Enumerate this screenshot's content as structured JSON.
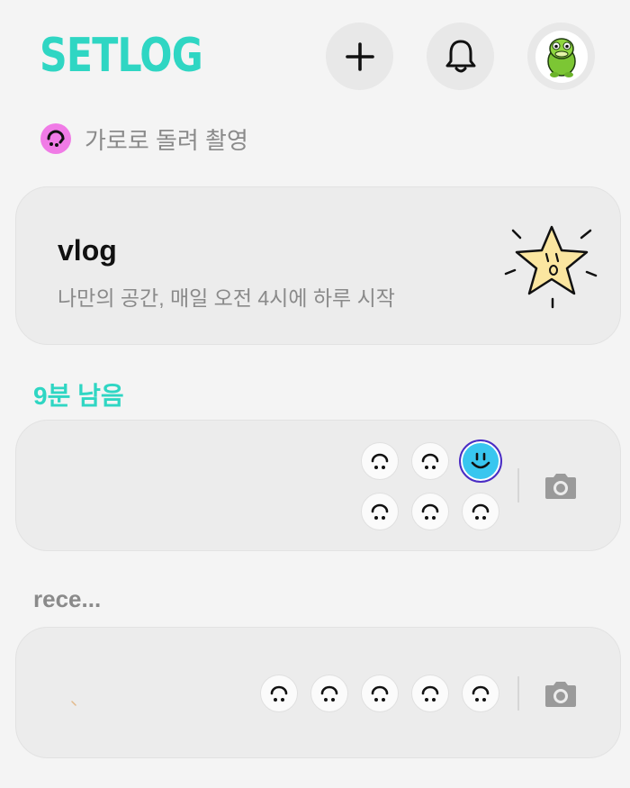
{
  "header": {
    "logo_text": "SETLOG",
    "add_icon": "plus-icon",
    "bell_icon": "bell-icon",
    "profile_icon": "green-character-avatar"
  },
  "rotate_hint": {
    "text": "가로로 돌려 촬영",
    "icon": "rotate-smiley-icon",
    "icon_color": "#f07be6"
  },
  "vlog_card": {
    "title": "vlog",
    "subtitle": "나만의 공간, 매일 오전 4시에 하루 시작",
    "icon": "star-character-icon"
  },
  "today": {
    "remaining_label": "9분 남음",
    "faces": [
      {
        "state": "empty"
      },
      {
        "state": "empty"
      },
      {
        "state": "active"
      },
      {
        "state": "empty"
      },
      {
        "state": "empty"
      },
      {
        "state": "empty"
      }
    ],
    "camera_icon": "camera-icon"
  },
  "recent": {
    "label": "rece...",
    "faces": [
      {
        "state": "empty"
      },
      {
        "state": "empty"
      },
      {
        "state": "empty"
      },
      {
        "state": "empty"
      },
      {
        "state": "empty"
      }
    ],
    "camera_icon": "camera-icon"
  },
  "colors": {
    "accent": "#2fd6c3",
    "active_face": "#38c6ef",
    "active_ring": "#4b2cc4",
    "background": "#f4f4f4",
    "card": "#ececec"
  }
}
